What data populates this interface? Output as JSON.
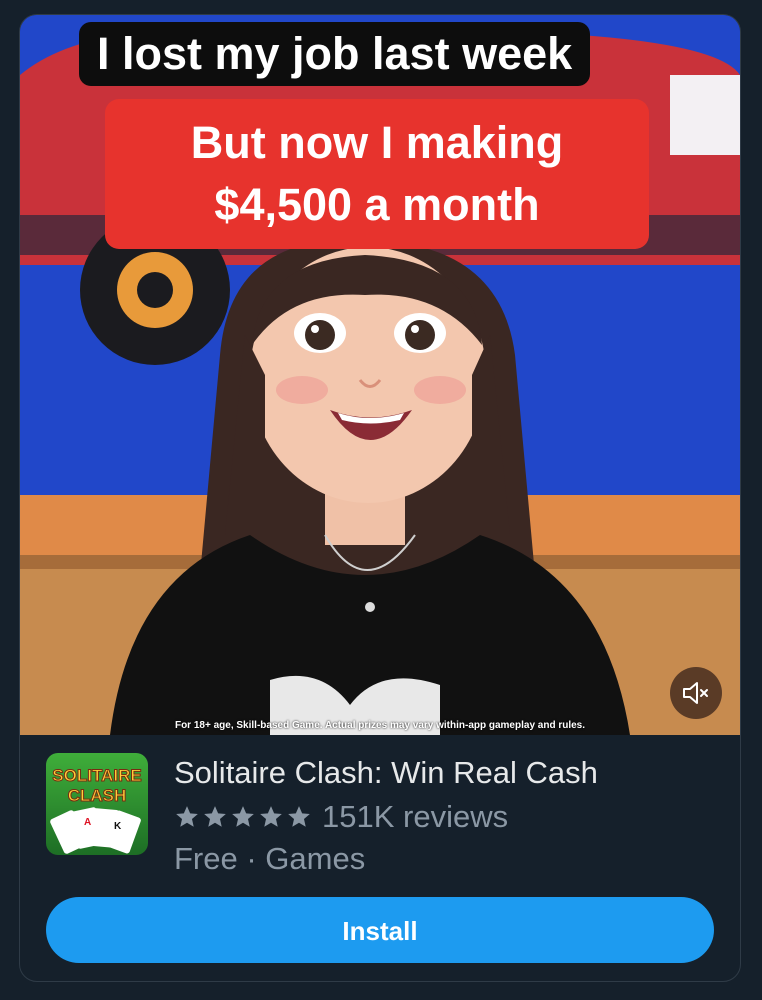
{
  "media": {
    "caption_line1": "I lost my job last week",
    "caption_line2a": "But now I making",
    "caption_line2b": "$4,500 a month",
    "disclaimer": "For 18+ age, Skill-based Game. Actual prizes may vary within-app gameplay and rules.",
    "mute_icon": "speaker-muted-icon"
  },
  "app": {
    "icon_text_1": "SOLITAIRE",
    "icon_text_2": "CLASH",
    "title": "Solitaire Clash: Win Real Cash",
    "rating_stars": 5,
    "reviews": "151K reviews",
    "category": "Free · Games",
    "install_label": "Install"
  },
  "colors": {
    "background": "#15202b",
    "accent": "#1d9bf0",
    "caption_red": "#e7332d",
    "muted_text": "#8b98a5"
  }
}
